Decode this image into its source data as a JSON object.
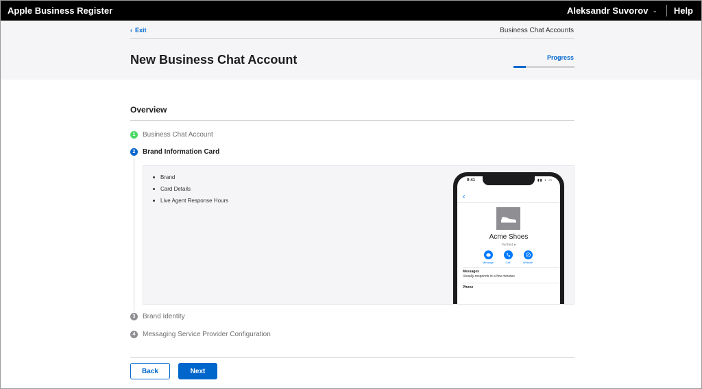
{
  "topbar": {
    "app_title": "Apple Business Register",
    "user_name": "Aleksandr Suvorov",
    "help_label": "Help"
  },
  "header": {
    "exit_label": "Exit",
    "breadcrumb": "Business Chat Accounts",
    "page_title": "New Business Chat Account",
    "progress_label": "Progress",
    "progress_value": 0.2
  },
  "overview": {
    "heading": "Overview",
    "steps": [
      {
        "number": "1",
        "label": "Business Chat Account",
        "state": "done"
      },
      {
        "number": "2",
        "label": "Brand Information Card",
        "state": "active"
      },
      {
        "number": "3",
        "label": "Brand Identity",
        "state": "todo"
      },
      {
        "number": "4",
        "label": "Messaging Service Provider Configuration",
        "state": "todo"
      }
    ],
    "card_items": [
      "Brand",
      "Card Details",
      "Live Agent Response Hours"
    ]
  },
  "preview": {
    "time": "9:41",
    "business_name": "Acme Shoes",
    "verified": "Verified",
    "actions": [
      "Message",
      "Call",
      "Website"
    ],
    "messages_title": "Messages",
    "messages_desc": "Usually responds in a few minutes",
    "phone_title": "Phone"
  },
  "footer": {
    "back_label": "Back",
    "next_label": "Next"
  },
  "colors": {
    "accent": "#0066cc",
    "done": "#4cd964",
    "todo": "#8e8e93",
    "topbar": "#000000"
  }
}
